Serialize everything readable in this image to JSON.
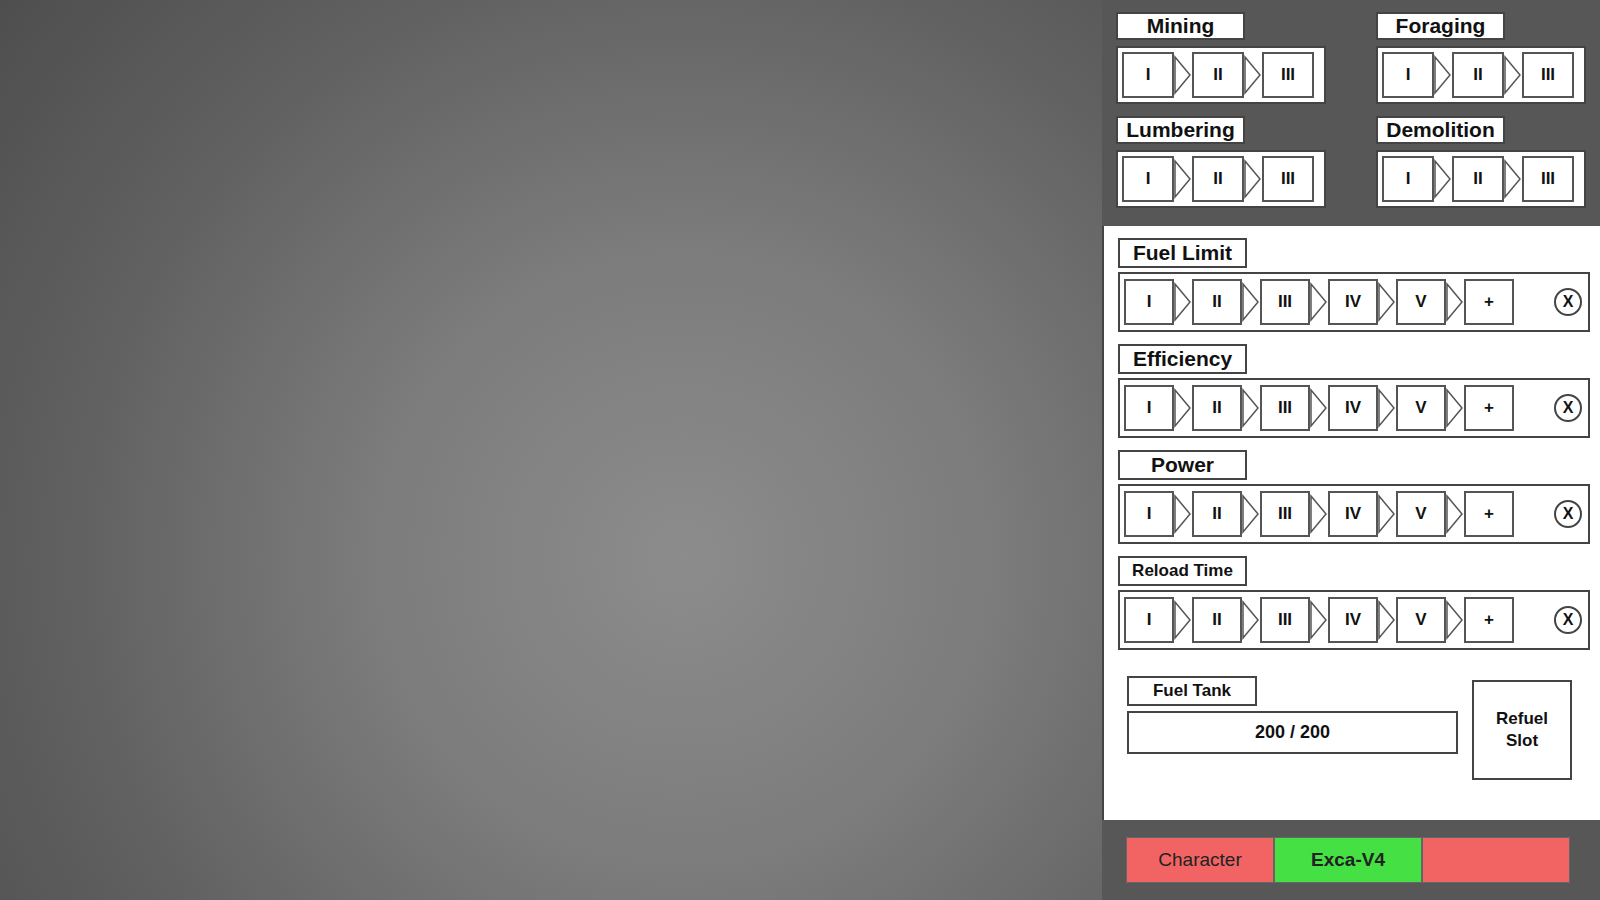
{
  "skills": [
    {
      "label": "Mining",
      "tiers": [
        "I",
        "II",
        "III"
      ]
    },
    {
      "label": "Foraging",
      "tiers": [
        "I",
        "II",
        "III"
      ]
    },
    {
      "label": "Lumbering",
      "tiers": [
        "I",
        "II",
        "III"
      ]
    },
    {
      "label": "Demolition",
      "tiers": [
        "I",
        "II",
        "III"
      ]
    }
  ],
  "upgrades": [
    {
      "label": "Fuel Limit",
      "tiers": [
        "I",
        "II",
        "III",
        "IV",
        "V",
        "+"
      ],
      "clear": "X"
    },
    {
      "label": "Efficiency",
      "tiers": [
        "I",
        "II",
        "III",
        "IV",
        "V",
        "+"
      ],
      "clear": "X"
    },
    {
      "label": "Power",
      "tiers": [
        "I",
        "II",
        "III",
        "IV",
        "V",
        "+"
      ],
      "clear": "X"
    },
    {
      "label": "Reload Time",
      "tiers": [
        "I",
        "II",
        "III",
        "IV",
        "V",
        "+"
      ],
      "clear": "X"
    }
  ],
  "fuel_tank": {
    "label": "Fuel Tank",
    "reading": "200 / 200"
  },
  "refuel_slot": {
    "label": "Refuel Slot"
  },
  "tabs": [
    {
      "label": "Character",
      "selected": false,
      "color": "#f26464"
    },
    {
      "label": "Exca-V4",
      "selected": true,
      "color": "#44e044"
    },
    {
      "label": "",
      "selected": false,
      "color": "#f26464"
    }
  ]
}
